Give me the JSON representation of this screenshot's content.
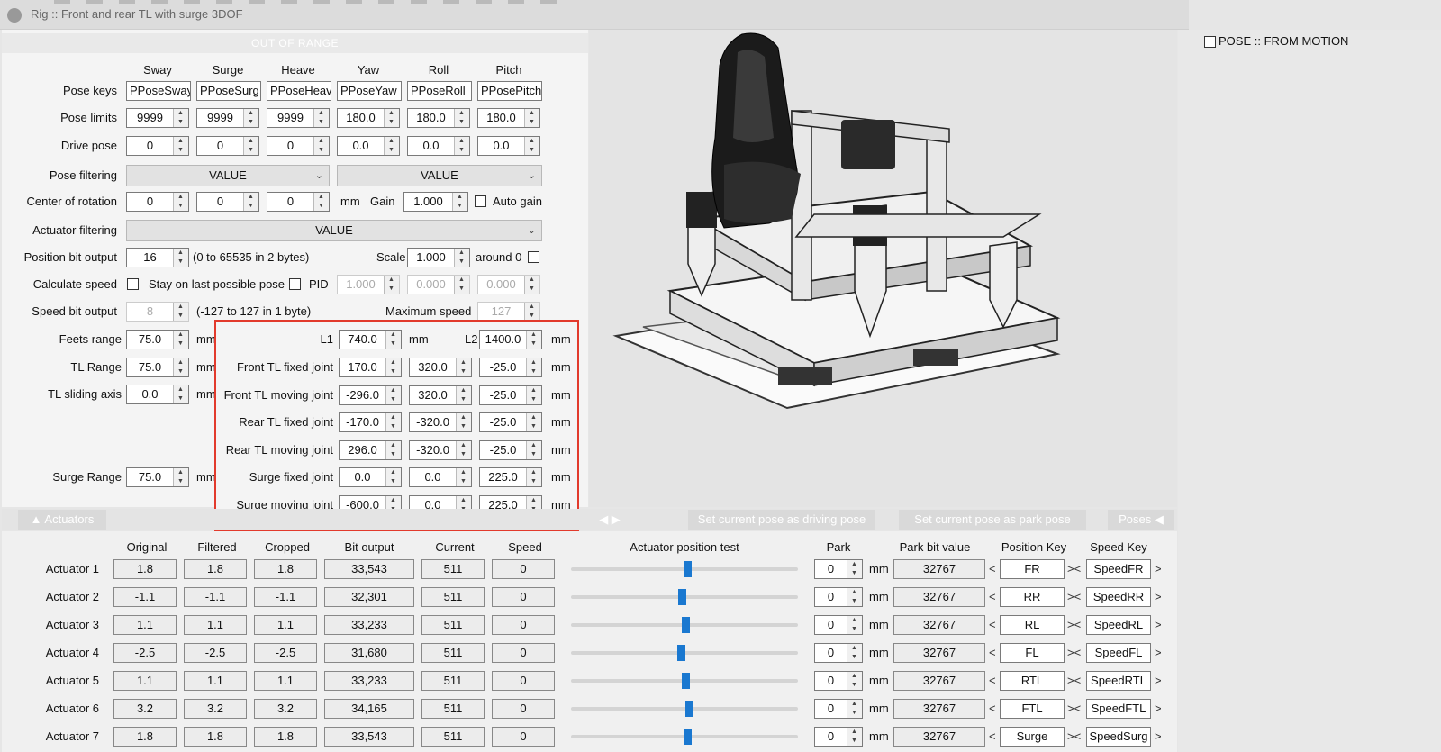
{
  "window": {
    "title": "Rig :: Front and rear TL with surge 3DOF"
  },
  "banner": {
    "text": "OUT OF RANGE"
  },
  "columns": [
    "Sway",
    "Surge",
    "Heave",
    "Yaw",
    "Roll",
    "Pitch"
  ],
  "pose_keys": {
    "label": "Pose keys",
    "values": [
      "PPoseSway",
      "PPoseSurg",
      "PPoseHeav",
      "PPoseYaw",
      "PPoseRoll",
      "PPosePitch"
    ]
  },
  "pose_limits": {
    "label": "Pose limits",
    "values": [
      "9999",
      "9999",
      "9999",
      "180.0",
      "180.0",
      "180.0"
    ]
  },
  "drive_pose": {
    "label": "Drive pose",
    "values": [
      "0",
      "0",
      "0",
      "0.0",
      "0.0",
      "0.0"
    ]
  },
  "pose_filtering": {
    "label": "Pose filtering",
    "left": "VALUE",
    "right": "VALUE"
  },
  "center_of_rotation": {
    "label": "Center of rotation",
    "values": [
      "0",
      "0",
      "0"
    ],
    "unit": "mm",
    "gain_label": "Gain",
    "gain": "1.000",
    "auto_gain_label": "Auto gain"
  },
  "actuator_filtering": {
    "label": "Actuator filtering",
    "value": "VALUE"
  },
  "position_bit_output": {
    "label": "Position bit output",
    "value": "16",
    "note": "(0 to 65535 in 2 bytes)",
    "scale_label": "Scale",
    "scale": "1.000",
    "around_label": "around 0"
  },
  "calculate_speed": {
    "label": "Calculate speed",
    "stay_label": "Stay on last possible pose",
    "pid_label": "PID",
    "pid_values": [
      "1.000",
      "0.000",
      "0.000"
    ]
  },
  "speed_bit_output": {
    "label": "Speed bit output",
    "value": "8",
    "note": "(-127 to 127 in 1 byte)",
    "max_label": "Maximum speed",
    "max": "127"
  },
  "feets_range": {
    "label": "Feets range",
    "value": "75.0",
    "unit": "mm"
  },
  "tl_range": {
    "label": "TL Range",
    "value": "75.0",
    "unit": "mm"
  },
  "tl_sliding_axis": {
    "label": "TL sliding axis",
    "value": "0.0",
    "unit": "mm"
  },
  "surge_range": {
    "label": "Surge Range",
    "value": "75.0",
    "unit": "mm"
  },
  "geometry": {
    "l1_label": "L1",
    "l1": "740.0",
    "l2_label": "L2",
    "l2": "1400.0",
    "unit": "mm",
    "rows": [
      {
        "label": "Front TL fixed joint",
        "values": [
          "170.0",
          "320.0",
          "-25.0"
        ]
      },
      {
        "label": "Front TL moving joint",
        "values": [
          "-296.0",
          "320.0",
          "-25.0"
        ]
      },
      {
        "label": "Rear TL fixed joint",
        "values": [
          "-170.0",
          "-320.0",
          "-25.0"
        ]
      },
      {
        "label": "Rear TL moving joint",
        "values": [
          "296.0",
          "-320.0",
          "-25.0"
        ]
      },
      {
        "label": "Surge fixed joint",
        "values": [
          "0.0",
          "0.0",
          "225.0"
        ]
      },
      {
        "label": "Surge moving joint",
        "values": [
          "-600.0",
          "0.0",
          "225.0"
        ]
      }
    ]
  },
  "tabs": {
    "actuators": "Actuators",
    "set_driving": "Set current pose as driving pose",
    "set_park": "Set current pose as park pose",
    "poses": "Poses"
  },
  "right_panel": {
    "pose_from_motion": "POSE :: FROM MOTION"
  },
  "actuator_table": {
    "headers": {
      "original": "Original",
      "filtered": "Filtered",
      "cropped": "Cropped",
      "bit_output": "Bit output",
      "current": "Current",
      "speed": "Speed",
      "position_test": "Actuator position test",
      "park": "Park",
      "park_bit": "Park bit value",
      "position_key": "Position Key",
      "speed_key": "Speed Key"
    },
    "park_unit": "mm",
    "rows": [
      {
        "name": "Actuator 1",
        "original": "1.8",
        "filtered": "1.8",
        "cropped": "1.8",
        "bit_output": "33,543",
        "current": "511",
        "speed": "0",
        "test_level": 0.51,
        "park": "0",
        "park_bit": "32767",
        "position_key": "FR",
        "speed_key": "SpeedFR"
      },
      {
        "name": "Actuator 2",
        "original": "-1.1",
        "filtered": "-1.1",
        "cropped": "-1.1",
        "bit_output": "32,301",
        "current": "511",
        "speed": "0",
        "test_level": 0.49,
        "park": "0",
        "park_bit": "32767",
        "position_key": "RR",
        "speed_key": "SpeedRR"
      },
      {
        "name": "Actuator 3",
        "original": "1.1",
        "filtered": "1.1",
        "cropped": "1.1",
        "bit_output": "33,233",
        "current": "511",
        "speed": "0",
        "test_level": 0.505,
        "park": "0",
        "park_bit": "32767",
        "position_key": "RL",
        "speed_key": "SpeedRL"
      },
      {
        "name": "Actuator 4",
        "original": "-2.5",
        "filtered": "-2.5",
        "cropped": "-2.5",
        "bit_output": "31,680",
        "current": "511",
        "speed": "0",
        "test_level": 0.485,
        "park": "0",
        "park_bit": "32767",
        "position_key": "FL",
        "speed_key": "SpeedFL"
      },
      {
        "name": "Actuator 5",
        "original": "1.1",
        "filtered": "1.1",
        "cropped": "1.1",
        "bit_output": "33,233",
        "current": "511",
        "speed": "0",
        "test_level": 0.505,
        "park": "0",
        "park_bit": "32767",
        "position_key": "RTL",
        "speed_key": "SpeedRTL"
      },
      {
        "name": "Actuator 6",
        "original": "3.2",
        "filtered": "3.2",
        "cropped": "3.2",
        "bit_output": "34,165",
        "current": "511",
        "speed": "0",
        "test_level": 0.52,
        "park": "0",
        "park_bit": "32767",
        "position_key": "FTL",
        "speed_key": "SpeedFTL"
      },
      {
        "name": "Actuator 7",
        "original": "1.8",
        "filtered": "1.8",
        "cropped": "1.8",
        "bit_output": "33,543",
        "current": "511",
        "speed": "0",
        "test_level": 0.51,
        "park": "0",
        "park_bit": "32767",
        "position_key": "Surge",
        "speed_key": "SpeedSurg"
      }
    ]
  }
}
